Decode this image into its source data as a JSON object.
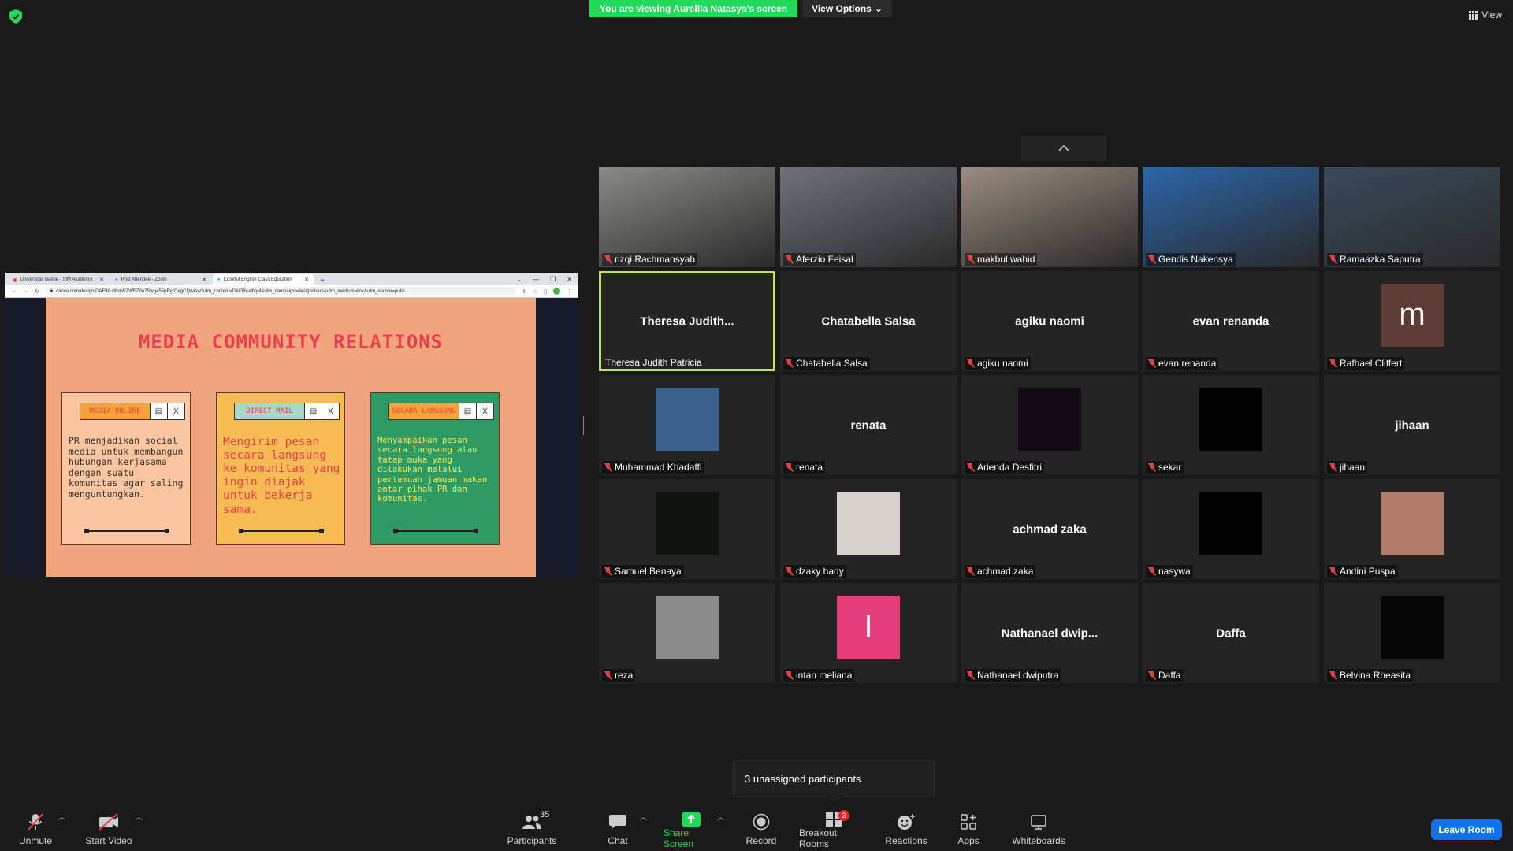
{
  "top": {
    "banner": "You are viewing Aurellia Natasya's screen",
    "view_options": "View Options",
    "view": "View"
  },
  "shared_screen": {
    "tabs": [
      {
        "label": "Universitas Bakrie - SIM Akademik"
      },
      {
        "label": "Post Attendee - Zoom"
      },
      {
        "label": "Colorful English Class Education"
      }
    ],
    "url": "canva.com/design/DAF8h-xlbqM/ZWEZ9u7Swg455pRyrOegCQ/view?utm_content=DAF8h-xlbqM&utm_campaign=designshare&utm_medium=link&utm_source=publi...",
    "slide_title": "MEDIA COMMUNITY RELATIONS",
    "cards": [
      {
        "label": "MEDIA ONLINE",
        "text": "PR menjadikan social media untuk membangun hubungan kerjasama dengan suatu komunitas agar saling menguntungkan.",
        "bg": "#fbc69f",
        "label_bg": "#f6a33b",
        "label_color": "#e8404a",
        "text_color": "#333333"
      },
      {
        "label": "DIRECT MAIL",
        "text": "Mengirim pesan secara langsung ke komunitas yang ingin diajak untuk bekerja sama.",
        "bg": "#f6bb55",
        "label_bg": "#a8d8c8",
        "label_color": "#e8404a",
        "text_color": "#e8404a"
      },
      {
        "label": "SECARA LANGSUNG",
        "text": "Menyampaikan pesan secara langsung atau tatap muka yang dilakukan melalui pertemuan jamuan makan antar pihak PR dan komunitas.",
        "bg": "#2f9a62",
        "label_bg": "#f6a33b",
        "label_color": "#e8404a",
        "text_color": "#f7e85a"
      }
    ]
  },
  "participants": [
    {
      "label": "rizqi Rachmansyah",
      "type": "video",
      "bg": "#8a8a86",
      "muted": true
    },
    {
      "label": "Aferzio Feisal",
      "type": "video",
      "bg": "#6e7378",
      "muted": true
    },
    {
      "label": "makbul wahid",
      "type": "video",
      "bg": "#9a8c80",
      "muted": true
    },
    {
      "label": "Gendis Nakensya",
      "type": "video",
      "bg": "#2b66a8",
      "muted": true
    },
    {
      "label": "Ramaazka Saputra",
      "type": "video",
      "bg": "#3a4a5a",
      "muted": true
    },
    {
      "label": "Theresa Judith Patricia",
      "type": "name",
      "display": "Theresa  Judith...",
      "muted": false,
      "speaking": true
    },
    {
      "label": "Chatabella Salsa",
      "type": "name",
      "display": "Chatabella Salsa",
      "muted": true
    },
    {
      "label": "agiku naomi",
      "type": "name",
      "display": "agiku naomi",
      "muted": true
    },
    {
      "label": "evan renanda",
      "type": "name",
      "display": "evan renanda",
      "muted": true
    },
    {
      "label": "Rafhael Cliffert",
      "type": "avatar",
      "initial": "m",
      "bg": "#5b3b33",
      "muted": true
    },
    {
      "label": "Muhammad Khadaffi",
      "type": "avatar",
      "initial": "",
      "bg": "#3a5f8a",
      "muted": true
    },
    {
      "label": "renata",
      "type": "name",
      "display": "renata",
      "muted": true
    },
    {
      "label": "Arienda Desfitri",
      "type": "avatar",
      "initial": "",
      "bg": "#140b16",
      "muted": true
    },
    {
      "label": "sekar",
      "type": "avatar",
      "initial": "",
      "bg": "#000000",
      "muted": true
    },
    {
      "label": "jihaan",
      "type": "name",
      "display": "jihaan",
      "muted": true
    },
    {
      "label": "Samuel Benaya",
      "type": "avatar",
      "initial": "",
      "bg": "#0f1410",
      "muted": true
    },
    {
      "label": "dzaky hady",
      "type": "avatar",
      "initial": "",
      "bg": "#d9d2cc",
      "muted": true
    },
    {
      "label": "achmad zaka",
      "type": "name",
      "display": "achmad zaka",
      "muted": true
    },
    {
      "label": "nasywa",
      "type": "avatar",
      "initial": "",
      "bg": "#000000",
      "muted": true
    },
    {
      "label": "Andini Puspa",
      "type": "avatar",
      "initial": "",
      "bg": "#b07a6a",
      "muted": true
    },
    {
      "label": "reza",
      "type": "avatar",
      "initial": "",
      "bg": "#8a8a8a",
      "muted": true
    },
    {
      "label": "intan meliana",
      "type": "avatar",
      "initial": "I",
      "bg": "#e6407a",
      "muted": true
    },
    {
      "label": "Nathanael dwiputra",
      "type": "name",
      "display": "Nathanael  dwip...",
      "muted": true
    },
    {
      "label": "Daffa",
      "type": "name",
      "display": "Daffa",
      "muted": true
    },
    {
      "label": "Belvina Rheasita",
      "type": "avatar",
      "initial": "",
      "bg": "#050505",
      "muted": true
    }
  ],
  "breakout_popup": "3 unassigned participants",
  "toolbar": {
    "unmute": "Unmute",
    "start_video": "Start Video",
    "participants": "Participants",
    "participants_count": "35",
    "chat": "Chat",
    "share_screen": "Share Screen",
    "record": "Record",
    "breakout_rooms": "Breakout Rooms",
    "breakout_badge": "3",
    "reactions": "Reactions",
    "apps": "Apps",
    "whiteboards": "Whiteboards",
    "leave": "Leave Room"
  },
  "colors": {
    "accent_green": "#23d959",
    "leave_blue": "#0e72ed",
    "speaker_border": "#c4e34e",
    "muted_red": "#e5413e"
  }
}
